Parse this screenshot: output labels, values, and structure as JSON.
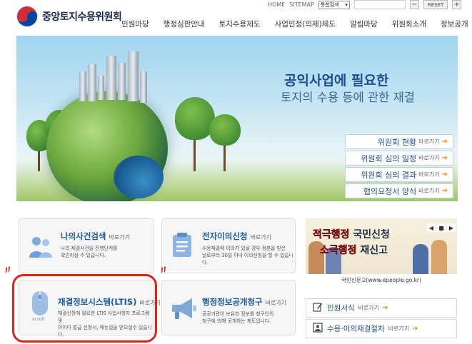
{
  "header": {
    "logo_text": "중앙토지수용위원회",
    "util": {
      "home": "HOME",
      "sitemap": "SITEMAP",
      "search_scope": "통합검색",
      "minus": "−",
      "reset": "RESET",
      "plus": "+"
    },
    "gnb": [
      "민원마당",
      "행정심판안내",
      "토지수용제도",
      "사업인정(의제)제도",
      "알림마당",
      "위원회소개",
      "정보공개"
    ]
  },
  "banner": {
    "title_line1": "공익사업에 필요한",
    "title_line2": "토지의 수용 등에 관한 재결",
    "go_label": "바로가기",
    "arrow": "➔",
    "quick_links": [
      "위원회 현황",
      "위원회 심의 일정",
      "위원회 심의 결과",
      "협의요청서 양식"
    ]
  },
  "services": {
    "go_label": "바로가기",
    "boxes": [
      {
        "title": "나의사건검색",
        "desc": "나의 재결사건을 진행단계를\n확인하실 수 있습니다."
      },
      {
        "title": "전자이의신청",
        "desc": "수용재결에 이의가 있을 경우 정본을 받은\n날로부터 30일 이내 이의신청을 할 수 있습니다."
      },
      {
        "title": "재결정보시스템(LTIS)",
        "desc": "재결신청에 필요한 LTIS 사업시행자 프로그램 및\n아이디 발급 신청서, 매뉴얼을 받으실수 있습니다."
      },
      {
        "title": "행정정보공개청구",
        "desc": "공공기관이 보유한 정보를 청구인의\n청구에 의해 공개하는 제도입니다."
      }
    ],
    "scroll_label": "scroll"
  },
  "promo": {
    "line1_a": "적극행정",
    "line1_b": "국민신청",
    "line2_a": "소극행정",
    "line2_b": "재신고",
    "prev": "◀",
    "pause": "■",
    "next": "▶",
    "caption": "국민신문고(www.epeople.go.kr)"
  },
  "links": {
    "go_label": "바로가기",
    "arrow": "➔",
    "items": [
      "민원서식",
      "수용·이의재결절차"
    ]
  }
}
